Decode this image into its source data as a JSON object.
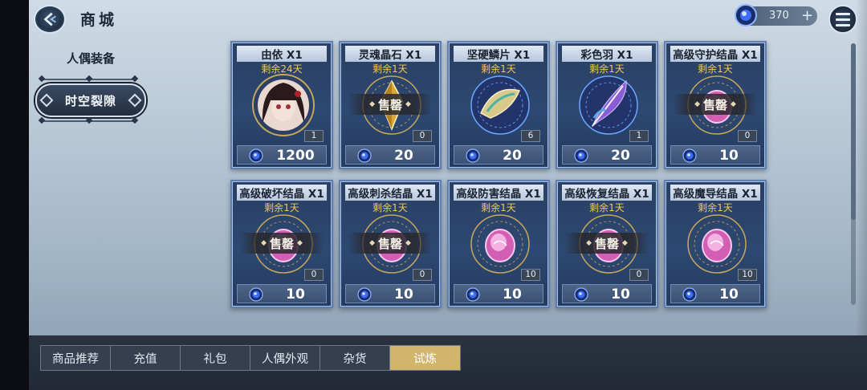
{
  "header": {
    "title": "商城"
  },
  "currency": {
    "amount": "370",
    "plus": "+"
  },
  "side_nav": {
    "label": "人偶装备",
    "active_item": "时空裂隙"
  },
  "colors": {
    "accent_gold": "#d0b56a",
    "card_border": "#5f7fb0",
    "remain_text": "#f2c94c"
  },
  "cards": [
    {
      "title": "由依 X1",
      "remain": "剩余24天",
      "count": "1",
      "price": "1200",
      "sold_out": false,
      "icon": "character-portrait-icon"
    },
    {
      "title": "灵魂晶石 X1",
      "remain": "剩余1天",
      "count": "0",
      "price": "20",
      "sold_out": true,
      "sold_label": "售罄",
      "icon": "gold-crystal-icon"
    },
    {
      "title": "坚硬鳞片 X1",
      "remain": "剩余1天",
      "count": "6",
      "price": "20",
      "sold_out": false,
      "icon": "scale-icon"
    },
    {
      "title": "彩色羽 X1",
      "remain": "剩余1天",
      "count": "1",
      "price": "20",
      "sold_out": false,
      "icon": "feather-icon"
    },
    {
      "title": "高级守护结晶 X1",
      "remain": "剩余1天",
      "count": "0",
      "price": "10",
      "sold_out": true,
      "sold_label": "售罄",
      "icon": "pink-crystal-icon"
    },
    {
      "title": "高级破坏结晶 X1",
      "remain": "剩余1天",
      "count": "0",
      "price": "10",
      "sold_out": true,
      "sold_label": "售罄",
      "icon": "pink-crystal-icon"
    },
    {
      "title": "高级刺杀结晶 X1",
      "remain": "剩余1天",
      "count": "0",
      "price": "10",
      "sold_out": true,
      "sold_label": "售罄",
      "icon": "pink-crystal-icon"
    },
    {
      "title": "高级防害结晶 X1",
      "remain": "剩余1天",
      "count": "10",
      "price": "10",
      "sold_out": false,
      "icon": "pink-crystal-icon"
    },
    {
      "title": "高级恢复结晶 X1",
      "remain": "剩余1天",
      "count": "0",
      "price": "10",
      "sold_out": true,
      "sold_label": "售罄",
      "icon": "pink-crystal-icon"
    },
    {
      "title": "高级魔导结晶 X1",
      "remain": "剩余1天",
      "count": "10",
      "price": "10",
      "sold_out": false,
      "icon": "pink-crystal-icon"
    }
  ],
  "tabs": [
    "商品推荐",
    "充值",
    "礼包",
    "人偶外观",
    "杂货",
    "试炼"
  ],
  "active_tab": "试炼"
}
